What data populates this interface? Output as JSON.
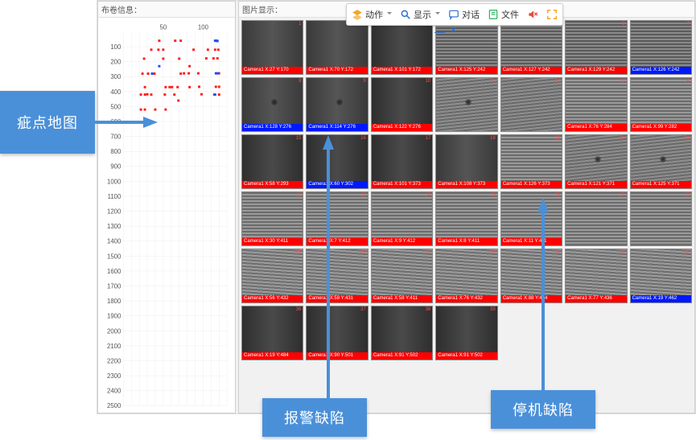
{
  "toolbar": {
    "action": "动作",
    "display": "显示",
    "dialog": "对话",
    "file": "文件",
    "mute_icon": "mute-icon",
    "expand_icon": "expand-icon",
    "minimize": "—",
    "close": "×"
  },
  "panels": {
    "left_title": "布卷信息：",
    "right_title": "图片显示："
  },
  "map": {
    "x_ticks": [
      "50",
      "100"
    ],
    "y_ticks": [
      "100",
      "200",
      "300",
      "400",
      "500",
      "600",
      "700",
      "800",
      "900",
      "1000",
      "1100",
      "1200",
      "1300",
      "1400",
      "1500",
      "1600",
      "1700",
      "1800",
      "1900",
      "2000",
      "2100",
      "2200",
      "2300",
      "2400",
      "2500"
    ]
  },
  "chart_data": {
    "type": "scatter",
    "title": "",
    "xlabel": "",
    "ylabel": "",
    "xlim": [
      0,
      130
    ],
    "ylim": [
      0,
      2500
    ],
    "series": [
      {
        "name": "red",
        "color": "#ff1a1a",
        "points": [
          [
            45,
            60
          ],
          [
            65,
            60
          ],
          [
            72,
            60
          ],
          [
            116,
            60
          ],
          [
            35,
            120
          ],
          [
            44,
            120
          ],
          [
            50,
            120
          ],
          [
            88,
            120
          ],
          [
            106,
            120
          ],
          [
            115,
            120
          ],
          [
            119,
            120
          ],
          [
            26,
            180
          ],
          [
            50,
            180
          ],
          [
            70,
            180
          ],
          [
            104,
            178
          ],
          [
            113,
            178
          ],
          [
            118,
            178
          ],
          [
            83,
            230
          ],
          [
            24,
            280
          ],
          [
            31,
            280
          ],
          [
            39,
            280
          ],
          [
            72,
            280
          ],
          [
            76,
            278
          ],
          [
            82,
            278
          ],
          [
            94,
            278
          ],
          [
            120,
            278
          ],
          [
            27,
            370
          ],
          [
            53,
            370
          ],
          [
            58,
            370
          ],
          [
            61,
            370
          ],
          [
            68,
            370
          ],
          [
            83,
            370
          ],
          [
            95,
            368
          ],
          [
            116,
            368
          ],
          [
            120,
            368
          ],
          [
            22,
            420
          ],
          [
            27,
            420
          ],
          [
            30,
            418
          ],
          [
            35,
            420
          ],
          [
            52,
            420
          ],
          [
            64,
            420
          ],
          [
            98,
            418
          ],
          [
            114,
            420
          ],
          [
            120,
            420
          ],
          [
            69,
            460
          ],
          [
            22,
            520
          ],
          [
            27,
            520
          ],
          [
            40,
            520
          ],
          [
            53,
            520
          ]
        ]
      },
      {
        "name": "blue",
        "color": "#1a4dff",
        "points": [
          [
            115,
            60
          ],
          [
            117,
            60
          ],
          [
            118,
            62
          ],
          [
            45,
            230
          ],
          [
            36,
            280
          ],
          [
            116,
            278
          ],
          [
            118,
            278
          ],
          [
            115,
            420
          ]
        ]
      }
    ]
  },
  "thumbs": [
    {
      "idx": "1",
      "tex": "tex-dark",
      "tag": "red",
      "label": "Camera1 X:27 Y:170"
    },
    {
      "idx": "2",
      "tex": "tex-dark",
      "tag": "red",
      "label": "Camera1 X:70 Y:172"
    },
    {
      "idx": "3",
      "tex": "tex-darker",
      "tag": "red",
      "label": "Camera1 X:101 Y:172"
    },
    {
      "idx": "4",
      "tex": "tex-stripe2",
      "tag": "red",
      "label": "Camera1 X:125 Y:242"
    },
    {
      "idx": "5",
      "tex": "tex-stripe2",
      "tag": "red",
      "label": "Camera1 X:127 Y:242"
    },
    {
      "idx": "6",
      "tex": "tex-stripe2",
      "tag": "red",
      "label": "Camera1 X:129 Y:242"
    },
    {
      "idx": "7",
      "tex": "tex-stripe2",
      "tag": "blue",
      "label": "Camera1 X:126 Y:242"
    },
    {
      "idx": "8",
      "tex": "tex-dark",
      "tag": "blue",
      "label": "Camera1 X:128 Y:276",
      "spot": true
    },
    {
      "idx": "9",
      "tex": "tex-dark",
      "tag": "blue",
      "label": "Camera1 X:114 Y:276",
      "spot": true
    },
    {
      "idx": "10",
      "tex": "tex-darker",
      "tag": "red",
      "label": "Camera1 X:122 Y:276"
    },
    {
      "idx": "11",
      "tex": "tex-diag",
      "tag": "",
      "label": "",
      "spot": true
    },
    {
      "idx": "12",
      "tex": "tex-diag",
      "tag": "",
      "label": ""
    },
    {
      "idx": "13",
      "tex": "tex-stripe",
      "tag": "red",
      "label": "Camera1 X:76 Y:284"
    },
    {
      "idx": "14",
      "tex": "tex-stripe",
      "tag": "red",
      "label": "Camera1 X:99 Y:282"
    },
    {
      "idx": "15",
      "tex": "tex-darker",
      "tag": "red",
      "label": "Camera1 X:58 Y:293"
    },
    {
      "idx": "16",
      "tex": "tex-darker",
      "tag": "blue",
      "label": "Camera1 X:60 Y:302"
    },
    {
      "idx": "17",
      "tex": "tex-darker",
      "tag": "red",
      "label": "Camera1 X:101 Y:373"
    },
    {
      "idx": "18",
      "tex": "tex-dark",
      "tag": "red",
      "label": "Camera1 X:108 Y:373"
    },
    {
      "idx": "19",
      "tex": "tex-stripe",
      "tag": "red",
      "label": "Camera1 X:126 Y:373"
    },
    {
      "idx": "20",
      "tex": "tex-diag",
      "tag": "red",
      "label": "Camera1 X:121 Y:371",
      "spot": true
    },
    {
      "idx": "21",
      "tex": "tex-diag",
      "tag": "red",
      "label": "Camera1 X:125 Y:371",
      "spot": true
    },
    {
      "idx": "22",
      "tex": "tex-stripe",
      "tag": "red",
      "label": "Camera1 X:30 Y:411"
    },
    {
      "idx": "23",
      "tex": "tex-stripe",
      "tag": "red",
      "label": "Camera1 X:7 Y:412"
    },
    {
      "idx": "24",
      "tex": "tex-stripe",
      "tag": "red",
      "label": "Camera1 X:9 Y:412"
    },
    {
      "idx": "25",
      "tex": "tex-stripe",
      "tag": "red",
      "label": "Camera1 X:8 Y:411"
    },
    {
      "idx": "26",
      "tex": "tex-stripe",
      "tag": "red",
      "label": "Camera1 X:11 Y:411"
    },
    {
      "idx": "27",
      "tex": "tex-stripe",
      "tag": "",
      "label": ""
    },
    {
      "idx": "28",
      "tex": "tex-stripe",
      "tag": "",
      "label": ""
    },
    {
      "idx": "29",
      "tex": "tex-wavy",
      "tag": "red",
      "label": "Camera1 X:56 Y:432"
    },
    {
      "idx": "30",
      "tex": "tex-wavy",
      "tag": "red",
      "label": "Camera1 X:58 Y:431"
    },
    {
      "idx": "31",
      "tex": "tex-wavy",
      "tag": "red",
      "label": "Camera1 X:58 Y:411"
    },
    {
      "idx": "32",
      "tex": "tex-wavy",
      "tag": "red",
      "label": "Camera1 X:76 Y:432"
    },
    {
      "idx": "33",
      "tex": "tex-wavy",
      "tag": "red",
      "label": "Camera1 X:88 Y:434"
    },
    {
      "idx": "34",
      "tex": "tex-wavy",
      "tag": "red",
      "label": "Camera1 X:77 Y:436"
    },
    {
      "idx": "35",
      "tex": "tex-wavy",
      "tag": "blue",
      "label": "Camera1 X:19 Y:462"
    },
    {
      "idx": "36",
      "tex": "tex-darker",
      "tag": "red",
      "label": "Camera1 X:19 Y:484"
    },
    {
      "idx": "37",
      "tex": "tex-darker",
      "tag": "red",
      "label": "Camera1 X:90 Y:501"
    },
    {
      "idx": "38",
      "tex": "tex-darker",
      "tag": "red",
      "label": "Camera1 X:91 Y:502"
    },
    {
      "idx": "39",
      "tex": "tex-darker",
      "tag": "red",
      "label": "Camera1 X:91 Y:502"
    },
    {
      "idx": "",
      "tex": "",
      "tag": "",
      "label": "",
      "empty": true
    },
    {
      "idx": "",
      "tex": "",
      "tag": "",
      "label": "",
      "empty": true
    },
    {
      "idx": "",
      "tex": "",
      "tag": "",
      "label": "",
      "empty": true
    }
  ],
  "annotations": {
    "map_label": "疵点地图",
    "alarm_label": "报警缺陷",
    "stop_label": "停机缺陷"
  },
  "colors": {
    "accent": "#4a90d9",
    "alarm": "#ff0000",
    "stop": "#0018ff"
  }
}
